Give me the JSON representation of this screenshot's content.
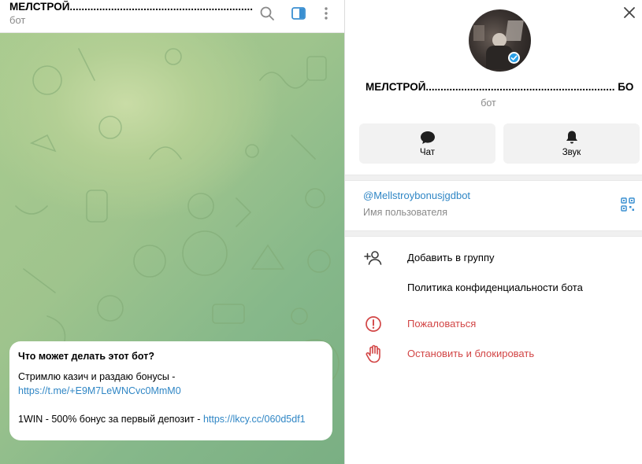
{
  "chat": {
    "title": "МЕЛСТРОЙ..............................................................",
    "subtitle": "бот",
    "header_icons": [
      "search-icon",
      "sidebar-toggle-icon",
      "more-vertical-icon"
    ],
    "bot_card": {
      "title": "Что может делать этот бот?",
      "line1": "Стримлю казич и раздаю бонусы  -",
      "link1": "https://t.me/+E9M7LeWNCvc0MmM0",
      "line2": "1WIN - 500% бонус за первый депозит - ",
      "link2": "https://lkcy.cc/060d5df1"
    }
  },
  "profile": {
    "name": "МЕЛСТРОЙ................................................................ БО...",
    "subtitle": "бот",
    "verified_icon": "verified-check-icon",
    "actions": [
      {
        "label": "Чат",
        "icon": "chat-bubble-icon"
      },
      {
        "label": "Звук",
        "icon": "bell-icon"
      }
    ],
    "username": "@Mellstroybonusjgdbot",
    "username_caption": "Имя пользователя",
    "qr_icon": "qr-code-icon",
    "menu": [
      {
        "label": "Добавить в группу",
        "icon": "add-user-icon",
        "danger": false
      },
      {
        "label": "Политика конфиденциальности бота",
        "icon": "",
        "danger": false
      },
      {
        "label": "Пожаловаться",
        "icon": "report-icon",
        "danger": true
      },
      {
        "label": "Остановить и блокировать",
        "icon": "hand-block-icon",
        "danger": true
      }
    ]
  },
  "colors": {
    "accent": "#2f86c5",
    "danger": "#d24545",
    "chat_background": "#9fc48d",
    "verified": "#2aa0e8"
  }
}
